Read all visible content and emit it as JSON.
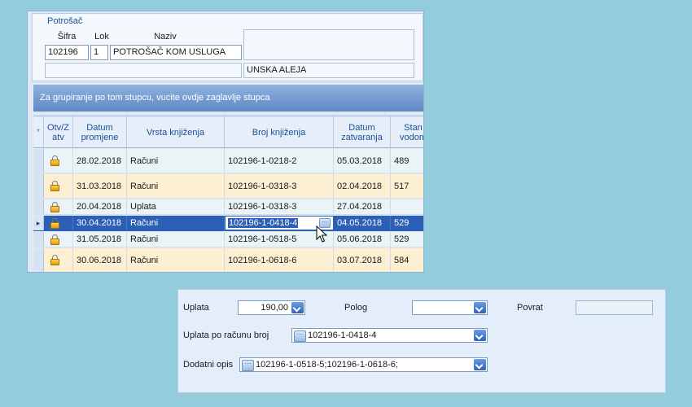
{
  "consumer": {
    "title": "Potrošač",
    "labels": {
      "sifra": "Šifra",
      "lok": "Lok",
      "naziv": "Naziv"
    },
    "sifra": "102196",
    "lok": "1",
    "naziv": "POTROŠAČ KOM USLUGA",
    "address": "UNSKA ALEJA"
  },
  "grid": {
    "group_hint": "Za grupiranje po tom stupcu, vucite ovdje zaglavlje stupca",
    "headers": {
      "star": "*",
      "otv": "Otv/Z atv",
      "datum_promjene": "Datum promjene",
      "vrsta": "Vrsta knjiženja",
      "broj": "Broj knjiženja",
      "datum_zatvaranja": "Datum zatvaranja",
      "stanje": "Stan vodom"
    },
    "rows": [
      {
        "datum": "28.02.2018",
        "vrsta": "Računi",
        "broj": "102196-1-0218-2",
        "zatv": "05.03.2018",
        "stanje": "489"
      },
      {
        "datum": "31.03.2018",
        "vrsta": "Računi",
        "broj": "102196-1-0318-3",
        "zatv": "02.04.2018",
        "stanje": "517"
      },
      {
        "datum": "20.04.2018",
        "vrsta": "Uplata",
        "broj": "102196-1-0318-3",
        "zatv": "27.04.2018",
        "stanje": ""
      },
      {
        "datum": "30.04.2018",
        "vrsta": "Računi",
        "broj": "102196-1-0418-4",
        "zatv": "04.05.2018",
        "stanje": "529"
      },
      {
        "datum": "31.05.2018",
        "vrsta": "Računi",
        "broj": "102196-1-0518-5",
        "zatv": "05.06.2018",
        "stanje": "529"
      },
      {
        "datum": "30.06.2018",
        "vrsta": "Računi",
        "broj": "102196-1-0618-6",
        "zatv": "03.07.2018",
        "stanje": "584"
      }
    ],
    "ellipsis": "···",
    "selected_indicator": "▸"
  },
  "payment": {
    "uplata_label": "Uplata",
    "uplata_value": "190,00",
    "polog_label": "Polog",
    "polog_value": "",
    "povrat_label": "Povrat",
    "povrat_value": "",
    "uplata_po_racunu_label": "Uplata po računu broj",
    "uplata_po_racunu_value": "102196-1-0418-4",
    "dodatni_opis_label": "Dodatni opis",
    "dodatni_opis_value": "102196-1-0518-5;102196-1-0618-6;",
    "ellipsis": "···"
  },
  "colors": {
    "background": "#93cddc",
    "selected_row": "#2c5fb6",
    "row_even": "#eaf3f6",
    "row_odd": "#fdf0d2"
  }
}
